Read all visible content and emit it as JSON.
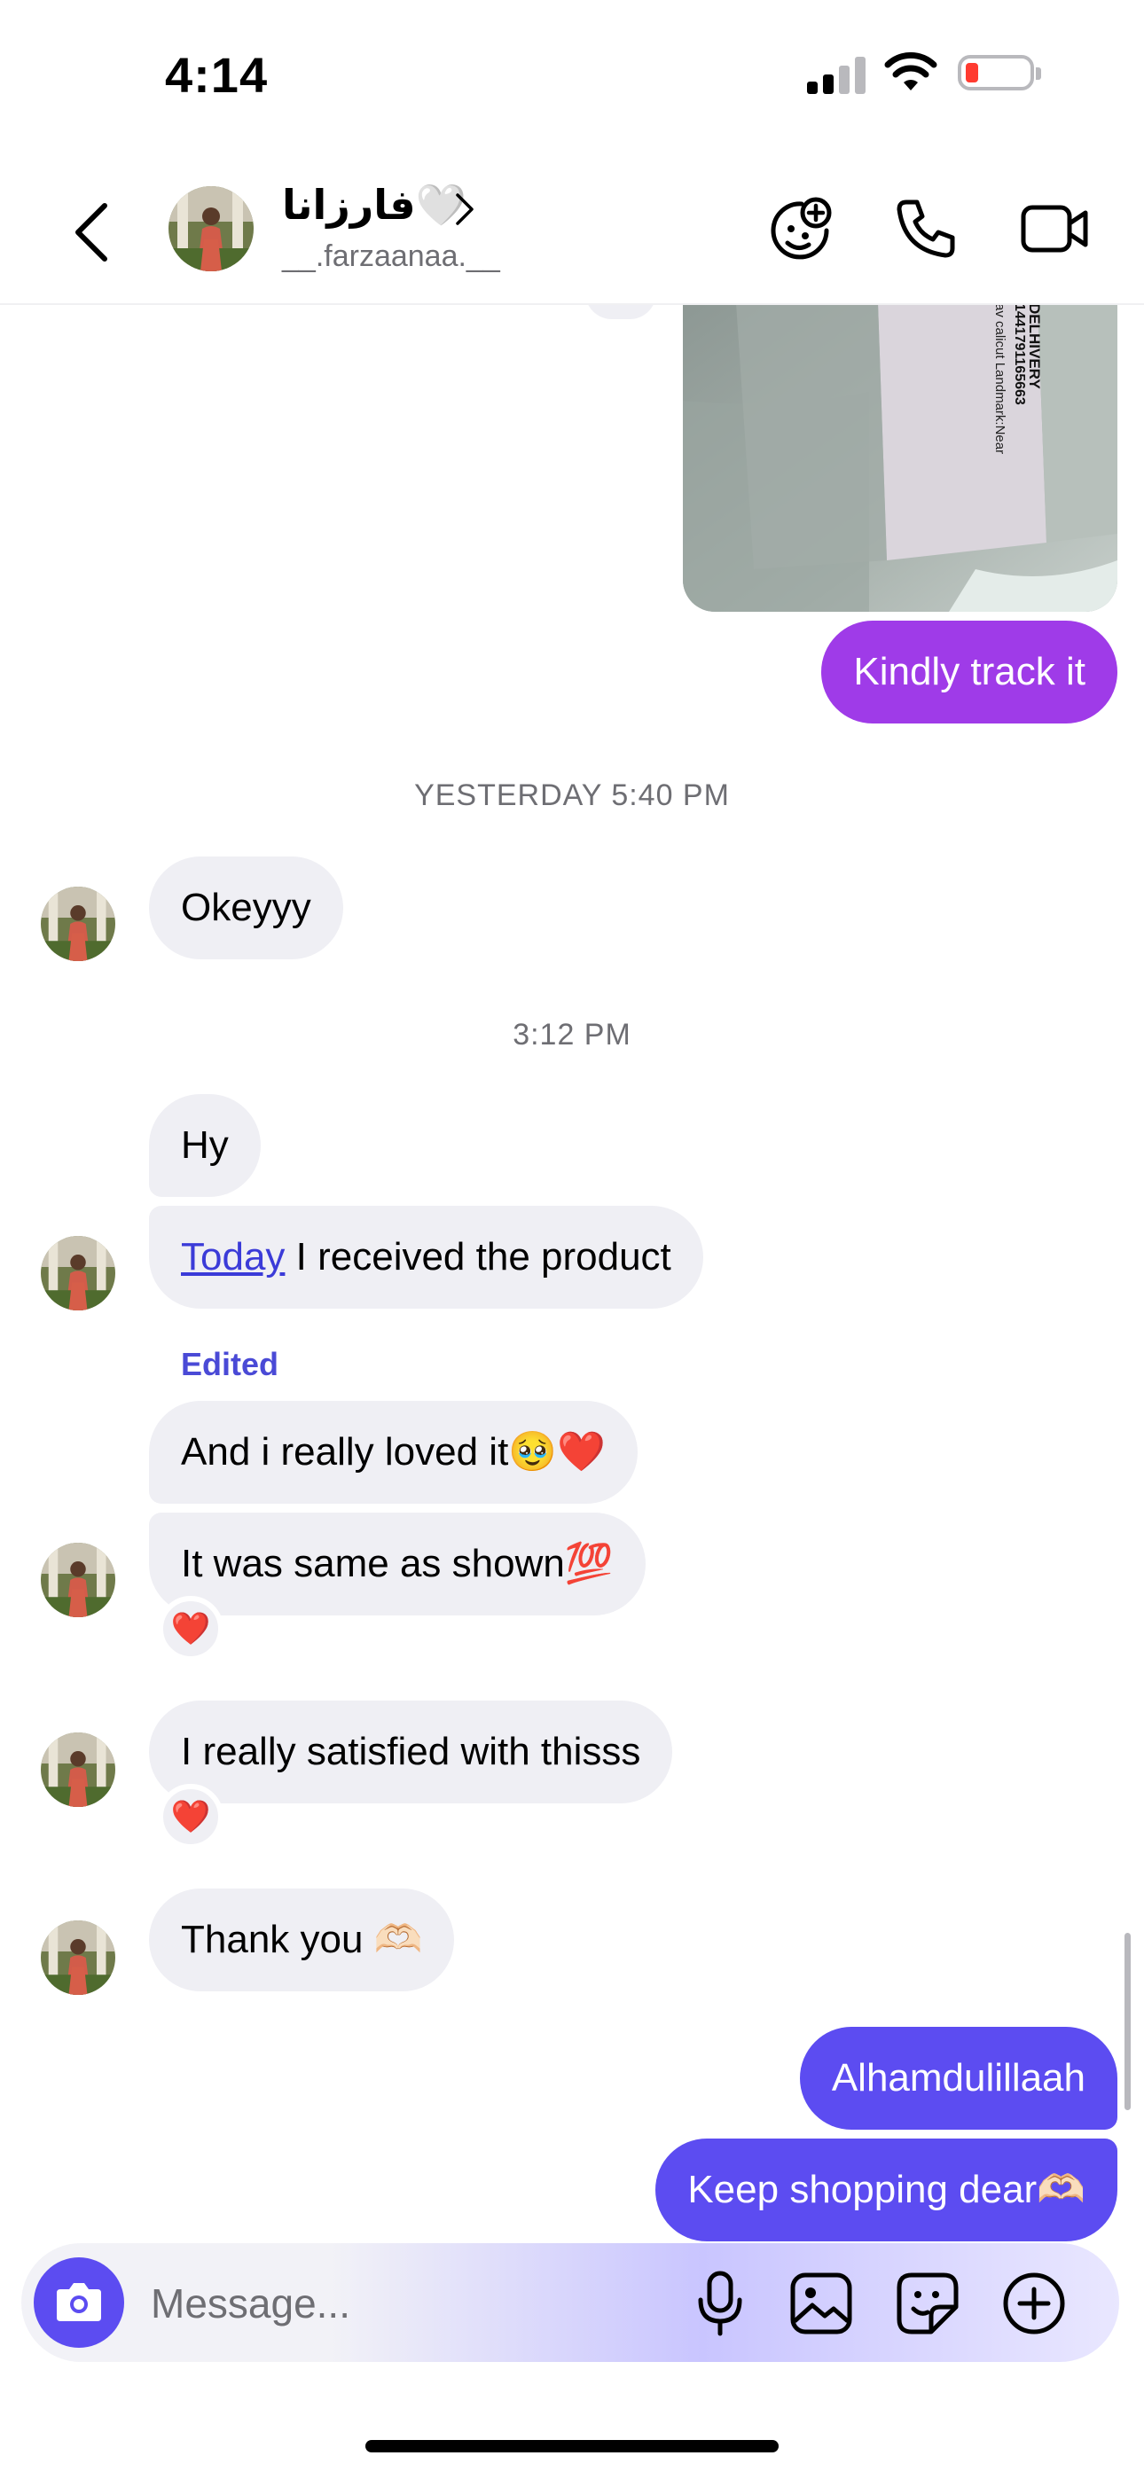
{
  "status_bar": {
    "time": "4:14"
  },
  "header": {
    "contact_name": "فارزانا🤍",
    "username": "__.farzaanaa.__"
  },
  "photo_label": {
    "lines": [
      "DELHIVERY",
      "1441791165663",
      "av calicut Landmark:Near"
    ]
  },
  "messages": {
    "kindly": "Kindly track it",
    "ts_yesterday": "YESTERDAY 5:40 PM",
    "okeyyy": "Okeyyy",
    "ts_312": "3:12 PM",
    "hy": "Hy",
    "today_link": "Today",
    "received": " I received the product",
    "edited": "Edited",
    "loved": "And i really loved it🥹❤️",
    "same": "It was same as shown💯",
    "satisfied": "I really satisfied with thisss",
    "thankyou": "Thank you 🫶🏻",
    "alhamdulillaah": "Alhamdulillaah",
    "keep_shopping": "Keep shopping dear🫶🏻",
    "reaction": "❤️"
  },
  "composer": {
    "placeholder": "Message..."
  },
  "colors": {
    "accent_purple": "#9f3be8",
    "accent_blue": "#5c4cf1",
    "incoming_bubble": "#efeff4",
    "timestamp": "#6e6e73"
  },
  "icons": {
    "back": "chevron-left-icon",
    "effects": "face-plus-icon",
    "call": "phone-icon",
    "video": "video-camera-icon",
    "camera": "camera-icon",
    "mic": "microphone-icon",
    "gallery": "image-icon",
    "sticker": "sticker-icon",
    "more": "plus-circle-icon"
  }
}
